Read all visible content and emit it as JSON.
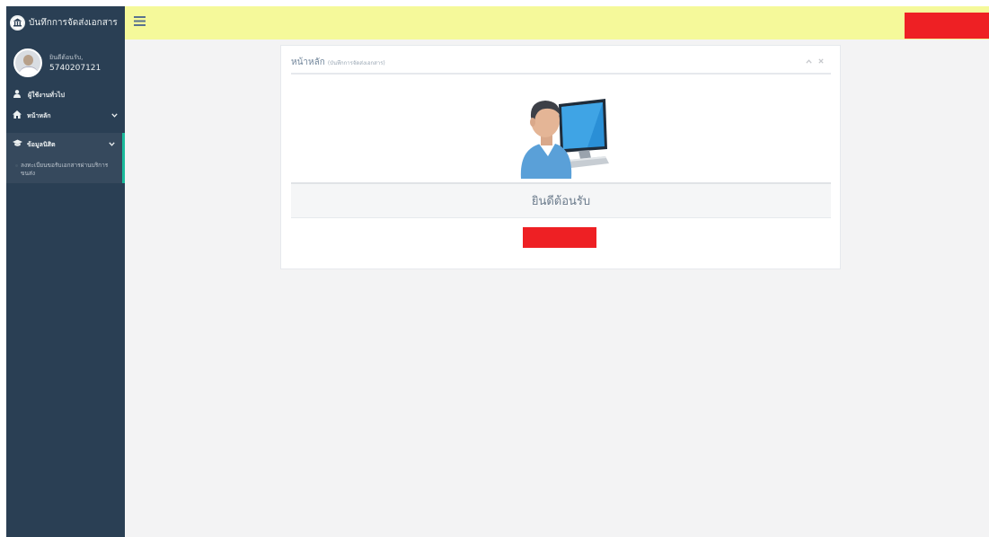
{
  "app": {
    "title": "บันทึกการจัดส่งเอกสาร",
    "logo_icon": "seal-logo-icon"
  },
  "sidebar": {
    "profile": {
      "greeting": "ยินดีต้อนรับ,",
      "user_id": "5740207121",
      "avatar_icon": "user-avatar-icon"
    },
    "role": {
      "icon": "user-icon",
      "label": "ผู้ใช้งานทั่วไป"
    },
    "items": [
      {
        "icon": "home-icon",
        "label": "หน้าหลัก",
        "chevron": "chevron-down-icon"
      },
      {
        "icon": "graduation-cap-icon",
        "label": "ข้อมูลนิสิต",
        "chevron": "chevron-down-icon"
      }
    ],
    "sub_items": [
      {
        "label": "ลงทะเบียนขอรับเอกสารผ่านบริการขนส่ง"
      }
    ]
  },
  "topbar": {
    "toggle_icon": "hamburger-menu-icon",
    "user_badge_color": "#ee2024"
  },
  "panel": {
    "title": "หน้าหลัก",
    "subtitle": "(บันทึกการจัดส่งเอกสาร)",
    "tools": [
      "chevron-up-icon",
      "close-icon"
    ],
    "illustration": "user-computer-icon",
    "welcome_text": "ยินดีต้อนรับ",
    "action_block_color": "#ee2024"
  },
  "colors": {
    "sidebar_bg": "#2a3f54",
    "topbar_bg": "#f5f99a",
    "active_accent": "#1abb9c",
    "content_bg": "#f3f3f4"
  }
}
